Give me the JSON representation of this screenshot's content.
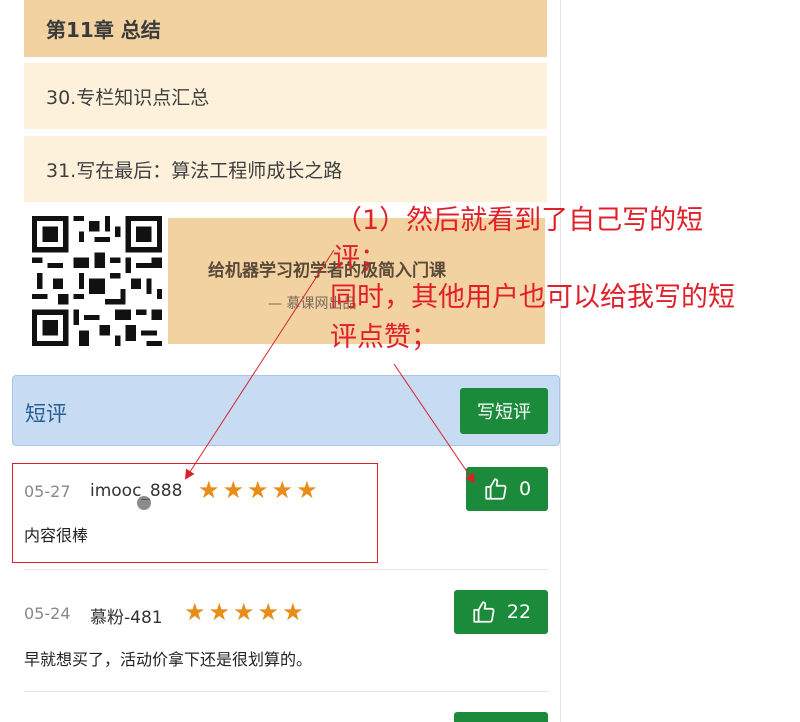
{
  "chapter": {
    "title": "第11章 总结"
  },
  "lessons": [
    {
      "label": "30.专栏知识点汇总"
    },
    {
      "label": "31.写在最后：算法工程师成长之路"
    }
  ],
  "promo": {
    "title": "给机器学习初学者的极简入门课",
    "subtitle": "— 慕课网出品"
  },
  "reviews_header": {
    "title": "短评",
    "write_button": "写短评"
  },
  "reviews": [
    {
      "date": "05-27",
      "user": "imooc_888",
      "rating": 5,
      "content": "内容很棒",
      "likes": "0"
    },
    {
      "date": "05-24",
      "user": "慕粉-481",
      "rating": 5,
      "content": "早就想买了，活动价拿下还是很划算的。",
      "likes": "22"
    }
  ],
  "annotation": {
    "line1": "（1）然后就看到了自己写的短",
    "line2": "评；",
    "line3": "同时，其他用户也可以给我写的短",
    "line4": "评点赞；"
  },
  "colors": {
    "chapter_bg": "#f1d2a0",
    "lesson_bg": "#fdf1dc",
    "header_bg": "#c7dcf2",
    "button_green": "#1b8a3a",
    "star": "#e88d1a",
    "annotation_red": "#e0202a"
  }
}
